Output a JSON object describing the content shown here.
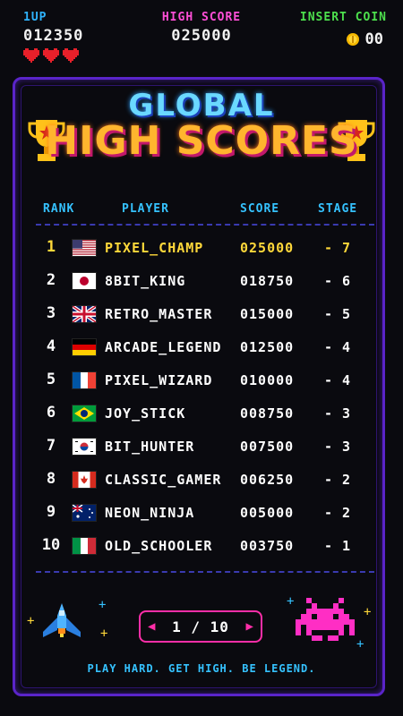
{
  "hud": {
    "player_label": "1UP",
    "player_score": "012350",
    "lives": 3,
    "high_score_label": "HIGH SCORE",
    "high_score": "025000",
    "insert_coin_label": "INSERT COIN",
    "coins": "00"
  },
  "title": {
    "line1": "GLOBAL",
    "line2": "HIGH SCORES"
  },
  "columns": {
    "rank": "RANK",
    "player": "PLAYER",
    "score": "SCORE",
    "stage": "STAGE"
  },
  "rows": [
    {
      "rank": "1",
      "flag": "us",
      "player": "PIXEL_CHAMP",
      "score": "025000",
      "stage": "- 7"
    },
    {
      "rank": "2",
      "flag": "jp",
      "player": "8BIT_KING",
      "score": "018750",
      "stage": "- 6"
    },
    {
      "rank": "3",
      "flag": "gb",
      "player": "RETRO_MASTER",
      "score": "015000",
      "stage": "- 5"
    },
    {
      "rank": "4",
      "flag": "de",
      "player": "ARCADE_LEGEND",
      "score": "012500",
      "stage": "- 4"
    },
    {
      "rank": "5",
      "flag": "fr",
      "player": "PIXEL_WIZARD",
      "score": "010000",
      "stage": "- 4"
    },
    {
      "rank": "6",
      "flag": "br",
      "player": "JOY_STICK",
      "score": "008750",
      "stage": "- 3"
    },
    {
      "rank": "7",
      "flag": "kr",
      "player": "BIT_HUNTER",
      "score": "007500",
      "stage": "- 3"
    },
    {
      "rank": "8",
      "flag": "ca",
      "player": "CLASSIC_GAMER",
      "score": "006250",
      "stage": "- 2"
    },
    {
      "rank": "9",
      "flag": "au",
      "player": "NEON_NINJA",
      "score": "005000",
      "stage": "- 2"
    },
    {
      "rank": "10",
      "flag": "it",
      "player": "OLD_SCHOOLER",
      "score": "003750",
      "stage": "- 1"
    }
  ],
  "pager": {
    "text": "1 / 10",
    "prev_icon": "prev-arrow-icon",
    "next_icon": "next-arrow-icon"
  },
  "tagline": "PLAY HARD. GET HIGH. BE LEGEND.",
  "colors": {
    "cyan": "#35c2ff",
    "magenta": "#ff2ea8",
    "gold": "#ffd83a",
    "frame": "#5a24c9",
    "green": "#4de04d"
  }
}
